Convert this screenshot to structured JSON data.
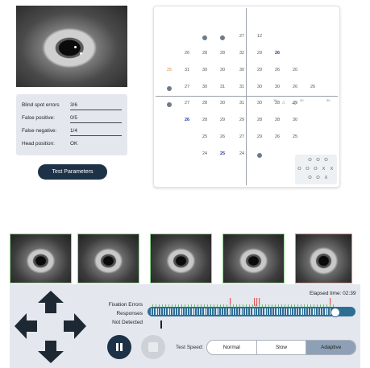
{
  "stats": {
    "rows": [
      {
        "label": "Blind spot errors",
        "value": "3/6"
      },
      {
        "label": "False positive:",
        "value": "0/5"
      },
      {
        "label": "False negative:",
        "value": "1/4"
      },
      {
        "label": "Head position:",
        "value": "OK"
      }
    ]
  },
  "params_button": "Test Parameters",
  "field": {
    "rows": [
      [
        "",
        "",
        "●",
        "●",
        "27",
        "12",
        "",
        "",
        ""
      ],
      [
        "",
        "26",
        "28",
        "28",
        "32",
        "29",
        "26",
        "",
        ""
      ],
      [
        "25",
        "31",
        "30",
        "30",
        "30",
        "29",
        "26",
        "20",
        ""
      ],
      [
        "●",
        "27",
        "30",
        "31",
        "31",
        "30",
        "30",
        "26",
        "26"
      ],
      [
        "●",
        "27",
        "28",
        "30",
        "31",
        "30",
        "28",
        "29",
        ""
      ],
      [
        "",
        "26",
        "28",
        "29",
        "29",
        "28",
        "28",
        "30",
        ""
      ],
      [
        "",
        "",
        "25",
        "26",
        "27",
        "29",
        "26",
        "25",
        ""
      ],
      [
        "",
        "",
        "24",
        "25",
        "24",
        "●",
        "",
        "",
        ""
      ]
    ],
    "blue_values": [
      "26",
      "26",
      "25"
    ],
    "orange_value": "25",
    "axis_ticks": [
      "10",
      "20",
      "30"
    ],
    "center_marker": "+0",
    "triangle_marker": "△",
    "legend": [
      [
        "O",
        "O",
        "O"
      ],
      [
        "O",
        "O",
        "O",
        "X",
        "X"
      ],
      [
        "O",
        "O",
        "X"
      ]
    ]
  },
  "controls": {
    "fixation_label": "Fixation Errors",
    "responses_label": "Responses",
    "not_detected_label": "Not Detected",
    "elapsed": "Elapsed time: 02:39",
    "speed_label": "Test Speed:",
    "speed_options": [
      "Normal",
      "Slow",
      "Adaptive"
    ],
    "speed_selected": "Adaptive",
    "progress": 0.9
  },
  "colors": {
    "navy": "#1d3247",
    "panel": "#e4e8ee",
    "blue_value": "#2b3aa0",
    "orange_value": "#e08a1a",
    "thumb_ok": "#8fd88f",
    "thumb_bad": "#e08a8a"
  },
  "icons": [
    "arrow-up-icon",
    "arrow-left-icon",
    "arrow-right-icon",
    "arrow-down-icon",
    "pause-icon",
    "stop-icon"
  ]
}
